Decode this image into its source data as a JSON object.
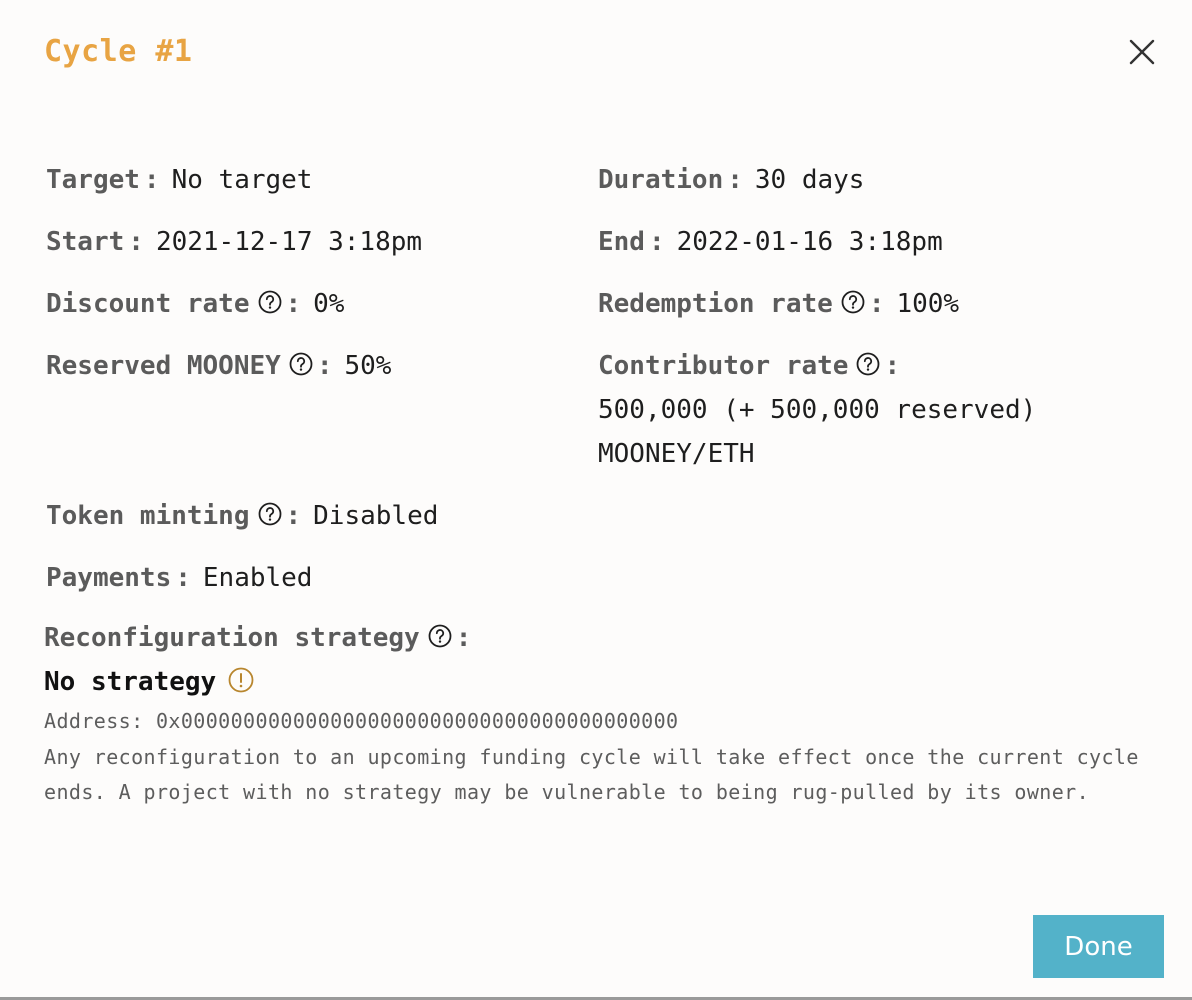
{
  "modal": {
    "title": "Cycle #1",
    "close_icon": "close-icon",
    "done_label": "Done"
  },
  "fields": {
    "target": {
      "label": "Target",
      "colon": ":",
      "value": "No target"
    },
    "duration": {
      "label": "Duration",
      "colon": ":",
      "value": "30 days"
    },
    "start": {
      "label": "Start",
      "colon": ":",
      "value": "2021-12-17 3:18pm"
    },
    "end": {
      "label": "End",
      "colon": ":",
      "value": "2022-01-16 3:18pm"
    },
    "discount_rate": {
      "label": "Discount rate",
      "colon": ":",
      "value": "0%",
      "icon": "help-icon"
    },
    "redemption_rate": {
      "label": "Redemption rate",
      "colon": ":",
      "value": "100%",
      "icon": "help-icon"
    },
    "reserved": {
      "label": "Reserved MOONEY",
      "colon": ":",
      "value": "50%",
      "icon": "help-icon"
    },
    "contributor_rate": {
      "label": "Contributor rate",
      "colon": ":",
      "value_line1": "500,000 (+ 500,000 reserved)",
      "value_line2": "MOONEY/ETH",
      "icon": "help-icon"
    },
    "token_minting": {
      "label": "Token minting",
      "colon": ":",
      "value": "Disabled",
      "icon": "help-icon"
    },
    "payments": {
      "label": "Payments",
      "colon": ":",
      "value": "Enabled"
    }
  },
  "reconfiguration": {
    "label": "Reconfiguration strategy",
    "colon": ":",
    "icon": "help-icon",
    "strategy": "No strategy",
    "warning_icon": "warning-icon",
    "warning_color": "#b8862e",
    "address": "Address: 0x0000000000000000000000000000000000000000",
    "note": "Any reconfiguration to an upcoming funding cycle will take effect once the current cycle ends. A project with no strategy may be vulnerable to being rug-pulled by its owner."
  },
  "colors": {
    "title": "#e8a443",
    "label": "#5b5b5b",
    "button": "#53b2c9",
    "background": "#fdfcfb"
  }
}
